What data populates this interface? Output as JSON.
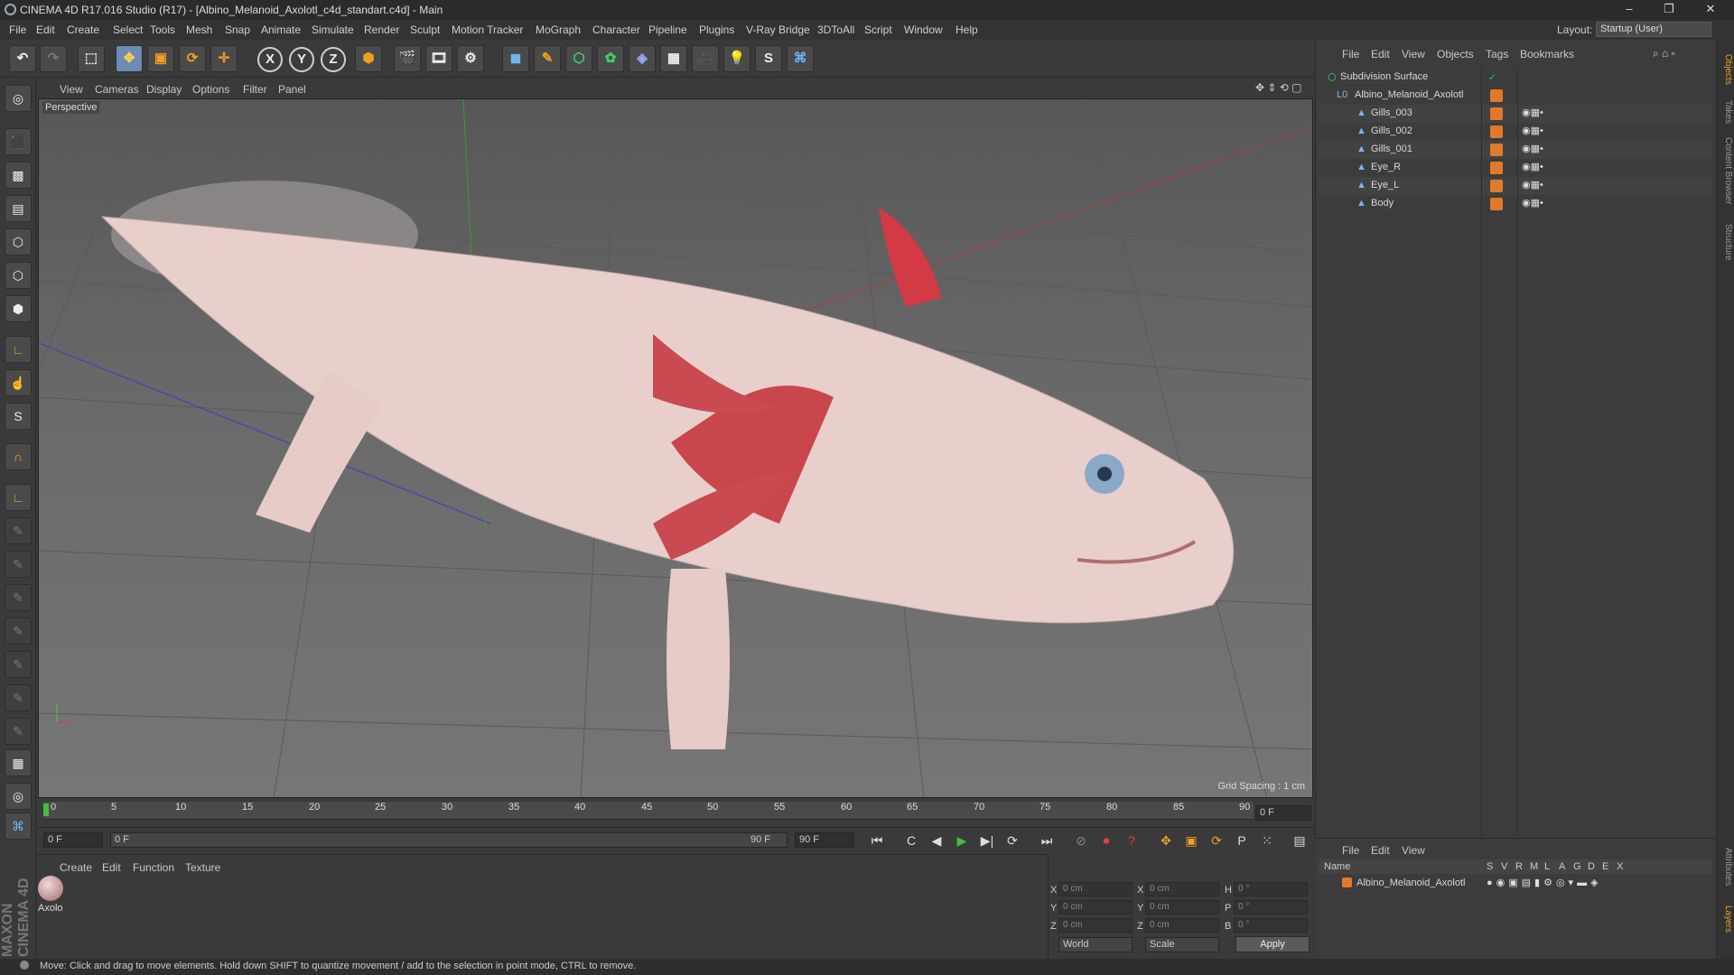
{
  "app": {
    "title": "CINEMA 4D R17.016 Studio (R17) - [Albino_Melanoid_Axolotl_c4d_standart.c4d] - Main",
    "window_controls": [
      "–",
      "❐",
      "✕"
    ]
  },
  "menu": [
    "File",
    "Edit",
    "Create",
    "Select",
    "Tools",
    "Mesh",
    "Snap",
    "Animate",
    "Simulate",
    "Render",
    "Sculpt",
    "Motion Tracker",
    "MoGraph",
    "Character",
    "Pipeline",
    "Plugins",
    "V-Ray Bridge",
    "3DToAll",
    "Script",
    "Window",
    "Help"
  ],
  "layout": {
    "label": "Layout:",
    "value": "Startup (User)"
  },
  "toolbar": {
    "axis_x": "X",
    "axis_y": "Y",
    "axis_z": "Z"
  },
  "viewport": {
    "menu": [
      "View",
      "Cameras",
      "Display",
      "Options",
      "Filter",
      "Panel"
    ],
    "label": "Perspective",
    "grid_spacing": "Grid Spacing : 1 cm"
  },
  "timeline": {
    "ticks": [
      "0",
      "5",
      "10",
      "15",
      "20",
      "25",
      "30",
      "35",
      "40",
      "45",
      "50",
      "55",
      "60",
      "65",
      "70",
      "75",
      "80",
      "85",
      "90"
    ],
    "frame_end_display": "0 F",
    "start_field": "0 F",
    "slider_start": "0 F",
    "slider_end": "90 F",
    "end_field": "90 F"
  },
  "material_panel": {
    "menu": [
      "Create",
      "Edit",
      "Function",
      "Texture"
    ],
    "material_name": "Axolo"
  },
  "coordinates": {
    "rows": [
      {
        "a": "X",
        "av": "0 cm",
        "b": "X",
        "bv": "0 cm",
        "c": "H",
        "cv": "0 °"
      },
      {
        "a": "Y",
        "av": "0 cm",
        "b": "Y",
        "bv": "0 cm",
        "c": "P",
        "cv": "0 °"
      },
      {
        "a": "Z",
        "av": "0 cm",
        "b": "Z",
        "bv": "0 cm",
        "c": "B",
        "cv": "0 °"
      }
    ],
    "world": "World",
    "scale": "Scale",
    "apply": "Apply"
  },
  "object_manager": {
    "menu": [
      "File",
      "Edit",
      "View",
      "Objects",
      "Tags",
      "Bookmarks"
    ],
    "objects": [
      {
        "name": "Subdivision Surface",
        "level": 0
      },
      {
        "name": "Albino_Melanoid_Axolotl",
        "level": 1
      },
      {
        "name": "Gills_003",
        "level": 2
      },
      {
        "name": "Gills_002",
        "level": 2
      },
      {
        "name": "Gills_001",
        "level": 2
      },
      {
        "name": "Eye_R",
        "level": 2
      },
      {
        "name": "Eye_L",
        "level": 2
      },
      {
        "name": "Body",
        "level": 2
      }
    ]
  },
  "layer_manager": {
    "menu": [
      "File",
      "Edit",
      "View"
    ],
    "headers": [
      "Name",
      "S",
      "V",
      "R",
      "M",
      "L",
      "A",
      "G",
      "D",
      "E",
      "X"
    ],
    "rows": [
      {
        "name": "Albino_Melanoid_Axolotl"
      }
    ]
  },
  "side_tabs": [
    "Objects",
    "Takes",
    "Content Browser",
    "Structure",
    "Attributes",
    "Layers"
  ],
  "status": "Move: Click and drag to move elements. Hold down SHIFT to quantize movement / add to the selection in point mode, CTRL to remove.",
  "branding": "MAXON CINEMA 4D",
  "colors": {
    "accent": "#6c8cb4",
    "tag_orange": "#e07a2a",
    "play_green": "#3fbf3f"
  }
}
